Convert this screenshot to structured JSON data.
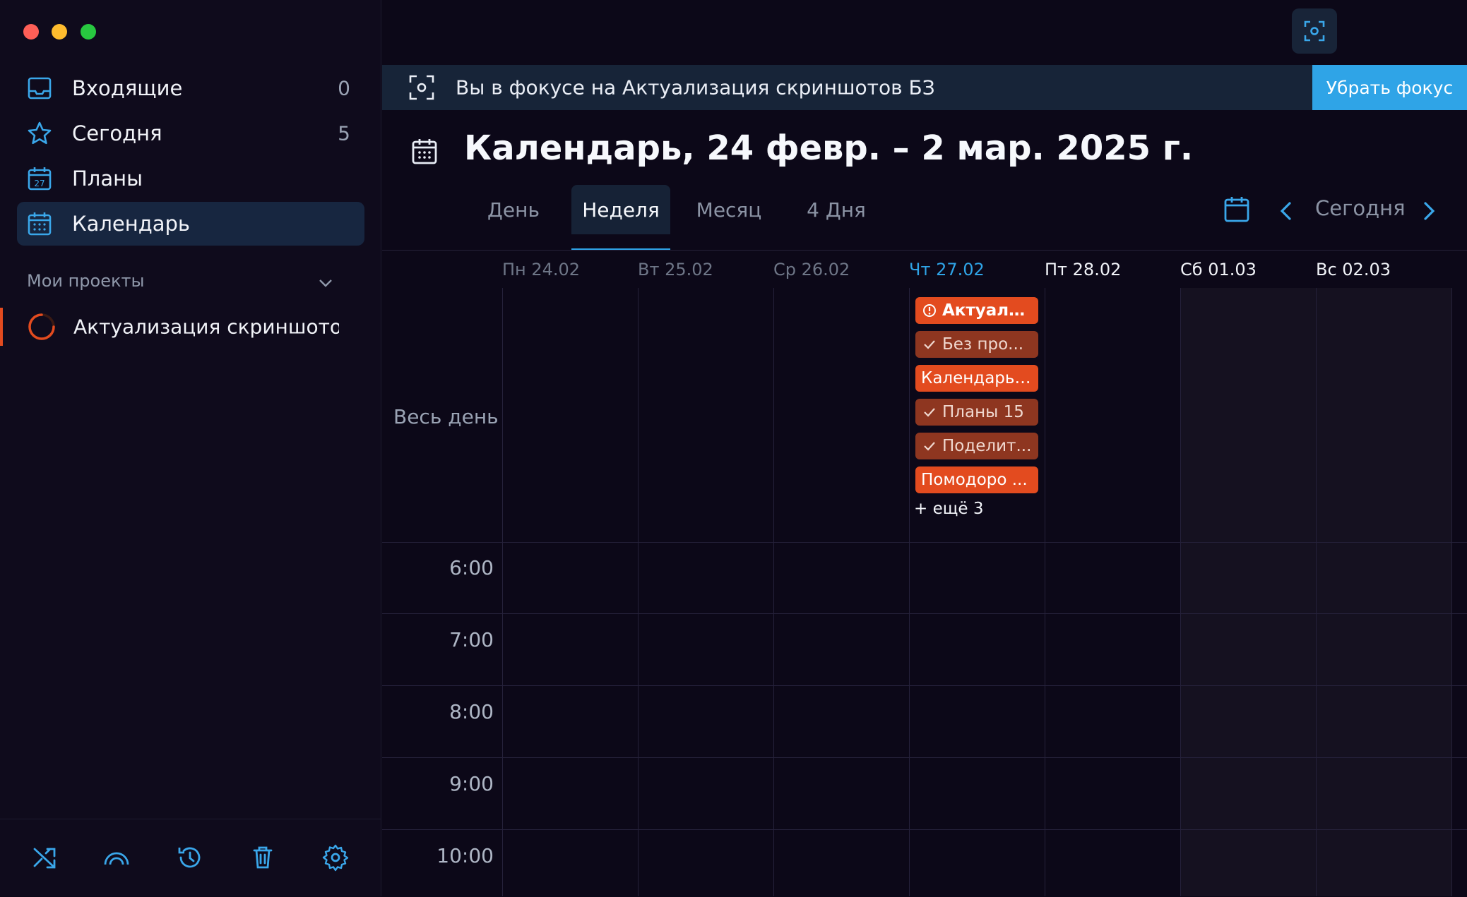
{
  "colors": {
    "accent": "#2fa4e7",
    "event_red": "#e34b1f",
    "event_done": "#8e3620",
    "sidebar_active": "#172640"
  },
  "sidebar": {
    "items": [
      {
        "label": "Входящие",
        "count": "0",
        "icon": "inbox-icon"
      },
      {
        "label": "Сегодня",
        "count": "5",
        "icon": "star-icon"
      },
      {
        "label": "Планы",
        "count": "",
        "icon": "calendar-27-icon"
      },
      {
        "label": "Календарь",
        "count": "",
        "icon": "calendar-grid-icon"
      }
    ],
    "projects_title": "Мои проекты",
    "project": {
      "label": "Актуализация скриншотов БЗ",
      "icon": "progress-ring-icon"
    },
    "footer_icons": [
      "shuffle-icon",
      "arc-icon",
      "history-icon",
      "trash-icon",
      "settings-icon"
    ]
  },
  "focus": {
    "text": "Вы в фокусе на Актуализация скриншотов БЗ",
    "button": "Убрать фокус"
  },
  "header": {
    "title": "Календарь, 24 февр. – 2 мар. 2025 г.",
    "tabs": [
      "День",
      "Неделя",
      "Месяц",
      "4 Дня"
    ],
    "active_tab": "Неделя",
    "today": "Сегодня"
  },
  "calendar": {
    "days": [
      "Пн 24.02",
      "Вт 25.02",
      "Ср 26.02",
      "Чт 27.02",
      "Пт 28.02",
      "Сб 01.03",
      "Вс 02.03"
    ],
    "allday_label": "Весь день",
    "times": [
      "6:00",
      "7:00",
      "8:00",
      "9:00",
      "10:00"
    ],
    "events": [
      {
        "text": "Актуали...",
        "kind": "overdue"
      },
      {
        "text": "Без про...",
        "kind": "done"
      },
      {
        "text": "Календарь ...",
        "kind": "plain"
      },
      {
        "text": "Планы 15",
        "kind": "done"
      },
      {
        "text": "Поделит...",
        "kind": "done"
      },
      {
        "text": "Помодоро ...",
        "kind": "plain"
      }
    ],
    "more": "+ ещё 3"
  }
}
